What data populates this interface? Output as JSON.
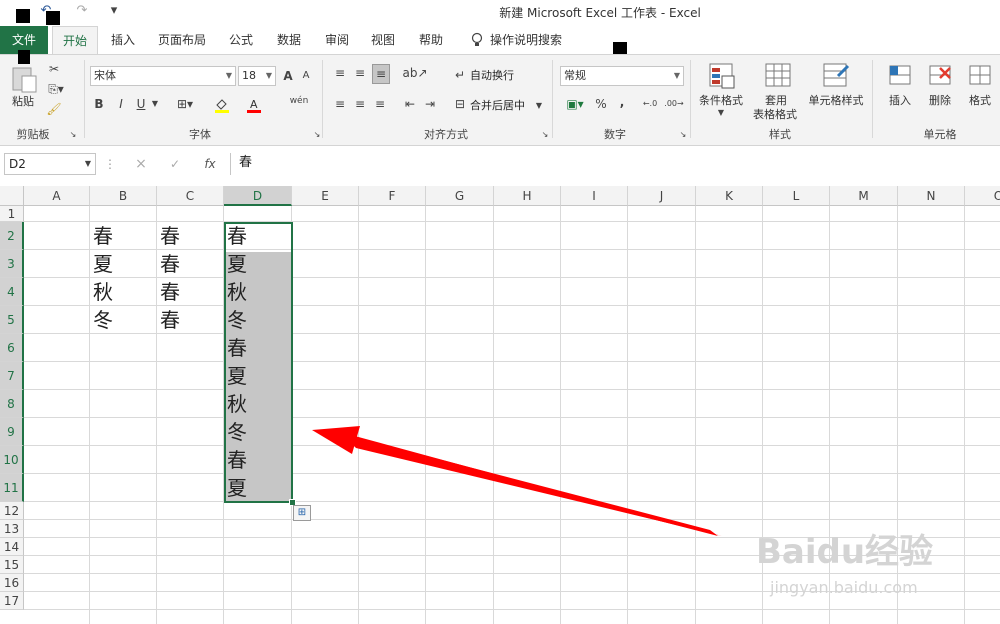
{
  "app": {
    "title": "新建 Microsoft Excel 工作表  -  Excel",
    "quick_access": {
      "undo": "↶",
      "redo": "↷",
      "customize": "▾"
    }
  },
  "tabs": [
    "文件",
    "开始",
    "插入",
    "页面布局",
    "公式",
    "数据",
    "审阅",
    "视图",
    "帮助"
  ],
  "tell_me": "操作说明搜索",
  "ribbon": {
    "clipboard": {
      "label": "剪贴板",
      "paste": "粘贴"
    },
    "font": {
      "label": "字体",
      "name": "宋体",
      "size": "18",
      "grow": "A",
      "shrink": "A",
      "bold": "B",
      "italic": "I",
      "underline": "U",
      "phonetic": "wén"
    },
    "alignment": {
      "label": "对齐方式",
      "wrap": "自动换行",
      "merge": "合并后居中"
    },
    "number": {
      "label": "数字",
      "format": "常规",
      "percent": "%",
      "comma": ","
    },
    "styles": {
      "label": "样式",
      "conditional": "条件格式",
      "table_line1": "套用",
      "table_line2": "表格格式",
      "cell_styles": "单元格样式"
    },
    "cells": {
      "label": "单元格",
      "insert": "插入",
      "delete": "删除",
      "format": "格式"
    }
  },
  "formula_bar": {
    "name_box": "D2",
    "fx": "fx",
    "cancel": "×",
    "enter": "✓",
    "value": "春"
  },
  "columns": [
    "A",
    "B",
    "C",
    "D",
    "E",
    "F",
    "G",
    "H",
    "I",
    "J",
    "K",
    "L",
    "M",
    "N",
    "O"
  ],
  "rows": [
    "1",
    "2",
    "3",
    "4",
    "5",
    "6",
    "7",
    "8",
    "9",
    "10",
    "11",
    "12",
    "13",
    "14",
    "15",
    "16",
    "17"
  ],
  "cells": {
    "B": [
      "春",
      "夏",
      "秋",
      "冬"
    ],
    "C": [
      "春",
      "春",
      "春",
      "春"
    ],
    "D": [
      "春",
      "夏",
      "秋",
      "冬",
      "春",
      "夏",
      "秋",
      "冬",
      "春",
      "夏"
    ]
  },
  "colors": {
    "accent": "#217346",
    "selection_fill": "#c6c6c6",
    "arrow": "#ff0000"
  },
  "watermark": {
    "line1": "Baidu经验",
    "line2": "jingyan.baidu.com"
  }
}
